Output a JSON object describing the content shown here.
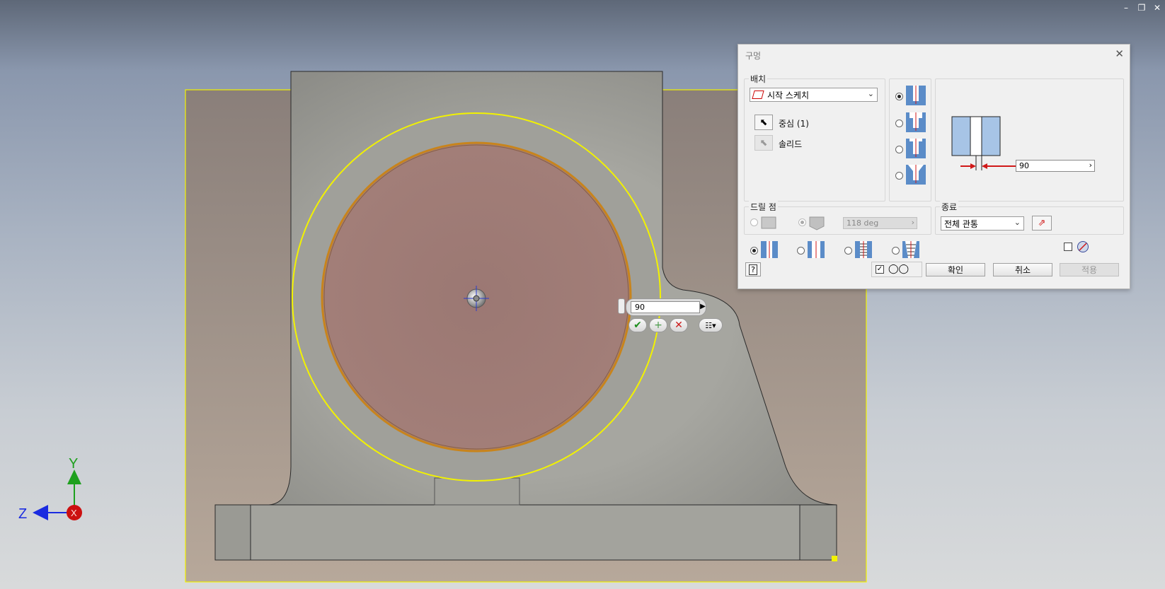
{
  "window_controls": {
    "minimize": "–",
    "restore": "❐",
    "close": "✕"
  },
  "viewcube": {
    "y_label": "Y",
    "z_label": "Z",
    "x_label": "X",
    "colors": {
      "y": "#1ea01e",
      "z": "#1a2be0",
      "x": "#cc1010"
    }
  },
  "mini_toolbar": {
    "value": "90"
  },
  "dialog": {
    "title": "구멍",
    "placement": {
      "group_label": "배치",
      "type_value": "시작 스케치",
      "center_label": "중심 (1)",
      "solid_label": "솔리드"
    },
    "preview": {
      "diameter_value": "90"
    },
    "drill_point": {
      "group_label": "드릴 점",
      "angle_value": "118 deg"
    },
    "termination": {
      "group_label": "종료",
      "value": "전체 관통"
    },
    "buttons": {
      "ok": "확인",
      "cancel": "취소",
      "apply": "적용"
    }
  },
  "colors": {
    "selection": "#f2f200",
    "face": "#9c7874",
    "accent_red": "#d01818"
  }
}
